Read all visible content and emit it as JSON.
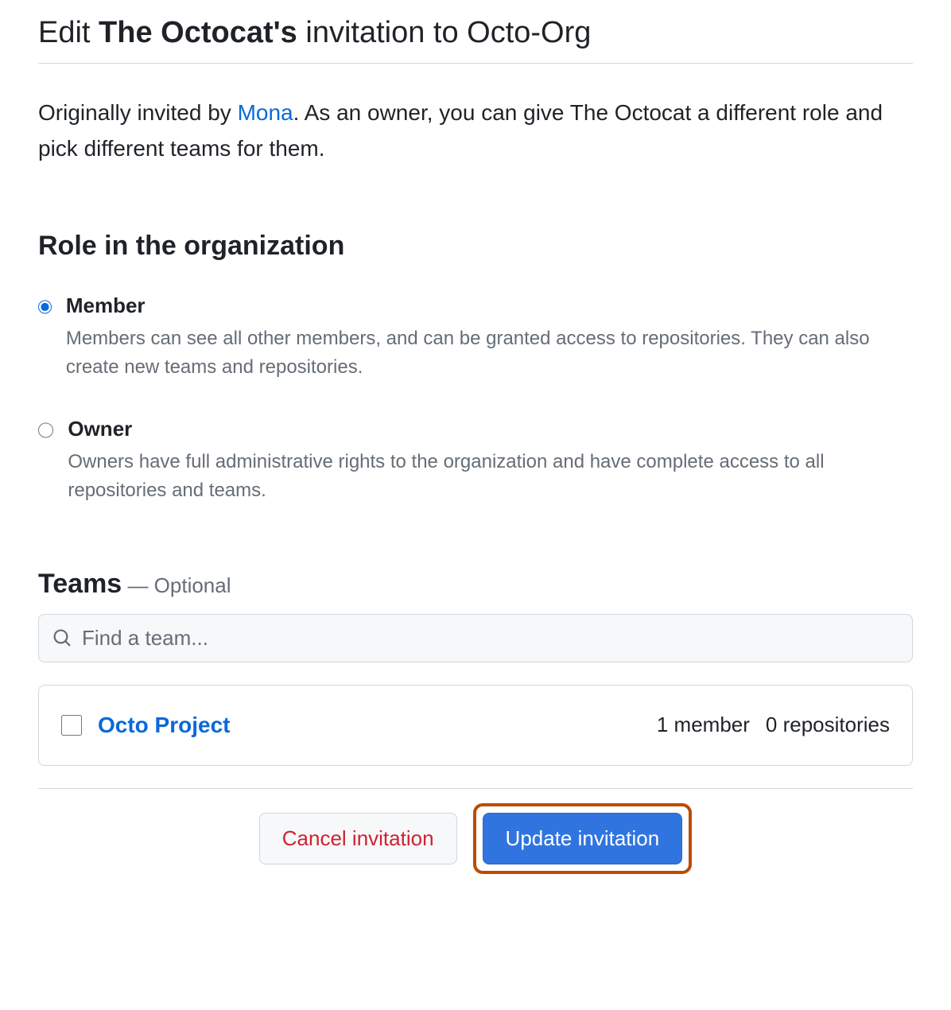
{
  "title": {
    "prefix": "Edit ",
    "bold": "The Octocat's",
    "suffix": " invitation to Octo-Org"
  },
  "description": {
    "prefix": "Originally invited by ",
    "inviter": "Mona",
    "suffix": ". As an owner, you can give The Octocat a different role and pick different teams for them."
  },
  "roleSection": {
    "heading": "Role in the organization",
    "options": [
      {
        "label": "Member",
        "description": "Members can see all other members, and can be granted access to repositories. They can also create new teams and repositories.",
        "checked": true
      },
      {
        "label": "Owner",
        "description": "Owners have full administrative rights to the organization and have complete access to all repositories and teams.",
        "checked": false
      }
    ]
  },
  "teamsSection": {
    "heading": "Teams",
    "optional": " — Optional",
    "searchPlaceholder": "Find a team...",
    "teams": [
      {
        "name": "Octo Project",
        "members": "1 member",
        "repositories": "0 repositories",
        "checked": false
      }
    ]
  },
  "actions": {
    "cancel": "Cancel invitation",
    "update": "Update invitation"
  }
}
